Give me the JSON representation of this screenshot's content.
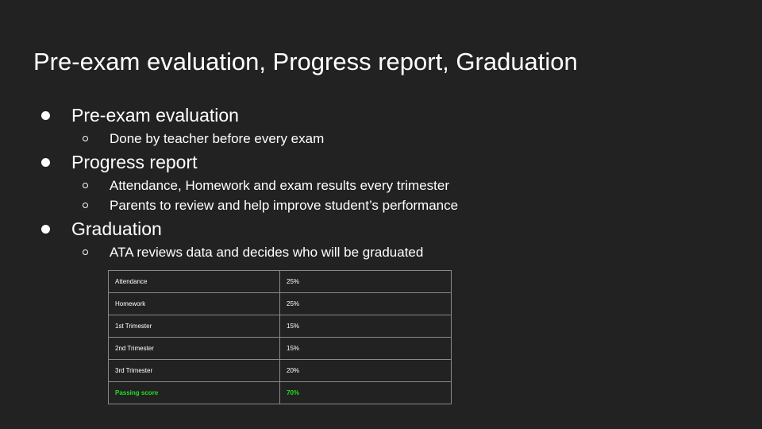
{
  "slide": {
    "title": "Pre-exam evaluation, Progress report, Graduation"
  },
  "sections": [
    {
      "heading": "Pre-exam evaluation",
      "items": [
        "Done by teacher before every exam"
      ]
    },
    {
      "heading": "Progress report",
      "items": [
        "Attendance, Homework and exam results every trimester",
        "Parents to review and help improve student’s performance"
      ]
    },
    {
      "heading": "Graduation",
      "items": [
        "ATA reviews data and decides who will be graduated"
      ]
    }
  ],
  "table": {
    "rows": [
      {
        "label": "Attendance",
        "value": "25%"
      },
      {
        "label": "Homework",
        "value": "25%"
      },
      {
        "label": "1st Trimester",
        "value": "15%"
      },
      {
        "label": "2nd Trimester",
        "value": "15%"
      },
      {
        "label": "3rd Trimester",
        "value": "20%"
      },
      {
        "label": "Passing score",
        "value": "70%"
      }
    ],
    "highlight_color": "#22dd22"
  }
}
